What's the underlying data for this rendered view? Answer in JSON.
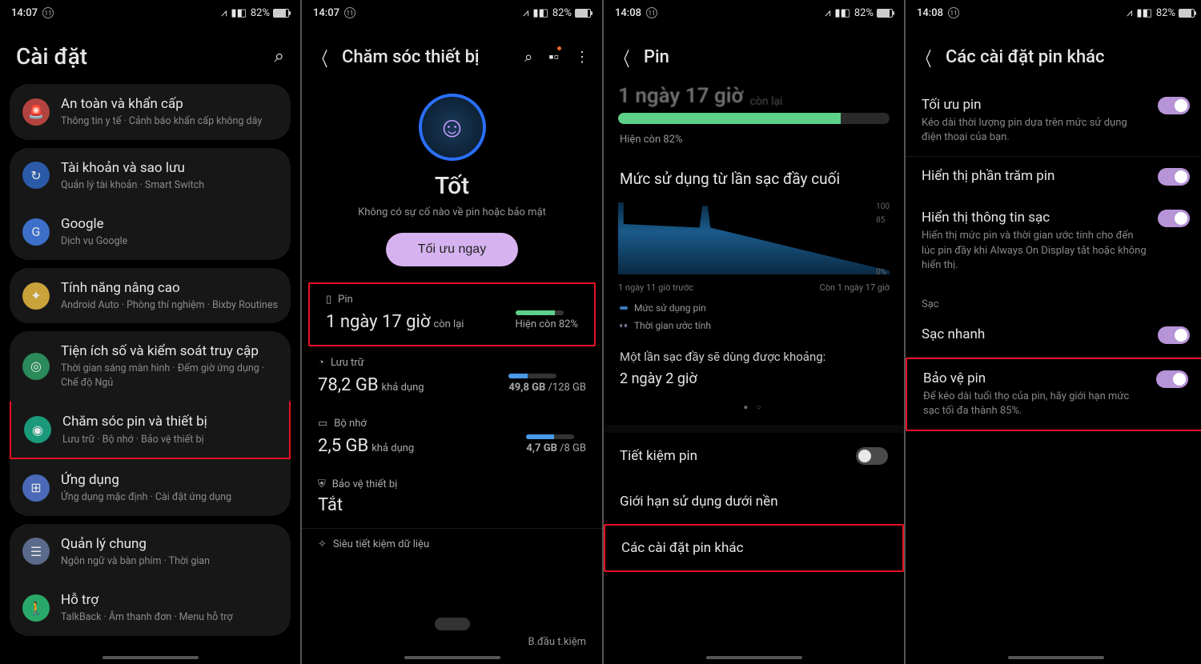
{
  "status": {
    "t1": "14:07",
    "t2": "14:07",
    "t3": "14:08",
    "t4": "14:08",
    "batt": "82%",
    "notif": "11"
  },
  "s1": {
    "title": "Cài đặt",
    "safety_t": "An toàn và khẩn cấp",
    "safety_s": "Thông tin y tế  ·  Cảnh báo khẩn cấp không dây",
    "acct_t": "Tài khoản và sao lưu",
    "acct_s": "Quản lý tài khoản  ·  Smart Switch",
    "google_t": "Google",
    "google_s": "Dịch vụ Google",
    "adv_t": "Tính năng nâng cao",
    "adv_s": "Android Auto  ·  Phòng thí nghiệm  ·  Bixby Routines",
    "dig_t": "Tiện ích số và kiểm soát truy cập",
    "dig_s": "Thời gian sáng màn hình  ·  Đếm giờ ứng dụng  ·  Chế độ Ngủ",
    "care_t": "Chăm sóc pin và thiết bị",
    "care_s": "Lưu trữ  ·  Bộ nhớ  ·  Bảo vệ thiết bị",
    "apps_t": "Ứng dụng",
    "apps_s": "Ứng dụng mặc định  ·  Cài đặt ứng dụng",
    "gen_t": "Quản lý chung",
    "gen_s": "Ngôn ngữ và bàn phím  ·  Thời gian",
    "supp_t": "Hỗ trợ",
    "supp_s": "TalkBack  ·  Âm thanh đơn  ·  Menu hỗ trợ"
  },
  "s2": {
    "title": "Chăm sóc thiết bị",
    "status_word": "Tốt",
    "status_sub": "Không có sự cố nào về pin hoặc bảo mật",
    "optimize": "Tối ưu ngay",
    "pin_label": "Pin",
    "pin_time": "1 ngày 17 giờ",
    "pin_left": "còn lại",
    "pin_now": "Hiện còn 82%",
    "storage_label": "Lưu trữ",
    "storage_free": "78,2 GB",
    "storage_avail": "khả dụng",
    "storage_used": "49,8 GB",
    "storage_total": "/128 GB",
    "mem_label": "Bộ nhớ",
    "mem_free": "2,5 GB",
    "mem_used": "4,7 GB",
    "mem_total": "/8 GB",
    "protect_label": "Bảo vệ thiết bị",
    "protect_val": "Tắt",
    "super_save": "Siêu tiết kiệm dữ liệu",
    "bottom": "B.đầu t.kiệm"
  },
  "s3": {
    "title": "Pin",
    "cutoff_main": "1 ngày 17 giờ",
    "cutoff_sub": "còn lại",
    "now": "Hiện còn 82%",
    "usage_title": "Mức sử dụng từ lần sạc đầy cuối",
    "y100": "100",
    "y85": "85",
    "y0": "0%",
    "xl": "1 ngày 11 giờ trước",
    "xr": "Còn 1 ngày 17 giờ",
    "leg1": "Mức sử dụng pin",
    "leg2": "Thời gian ước tính",
    "full_txt": "Một lần sạc đầy sẽ dùng được khoảng:",
    "full_val": "2 ngày 2 giờ",
    "save": "Tiết kiệm pin",
    "bg": "Giới hạn sử dụng dưới nền",
    "more": "Các cài đặt pin khác"
  },
  "s4": {
    "title": "Các cài đặt pin khác",
    "opt_t": "Tối ưu pin",
    "opt_s": "Kéo dài thời lượng pin dựa trên mức sử dụng điện thoại của bạn.",
    "pct_t": "Hiển thị phần trăm pin",
    "chg_t": "Hiển thị thông tin sạc",
    "chg_s": "Hiển thị mức pin và thời gian ước tính cho đến lúc pin đầy khi Always On Display tắt hoặc không hiển thị.",
    "section": "Sạc",
    "fast_t": "Sạc nhanh",
    "protect_t": "Bảo vệ pin",
    "protect_s": "Để kéo dài tuổi thọ của pin, hãy giới hạn mức sạc tối đa thành 85%."
  }
}
